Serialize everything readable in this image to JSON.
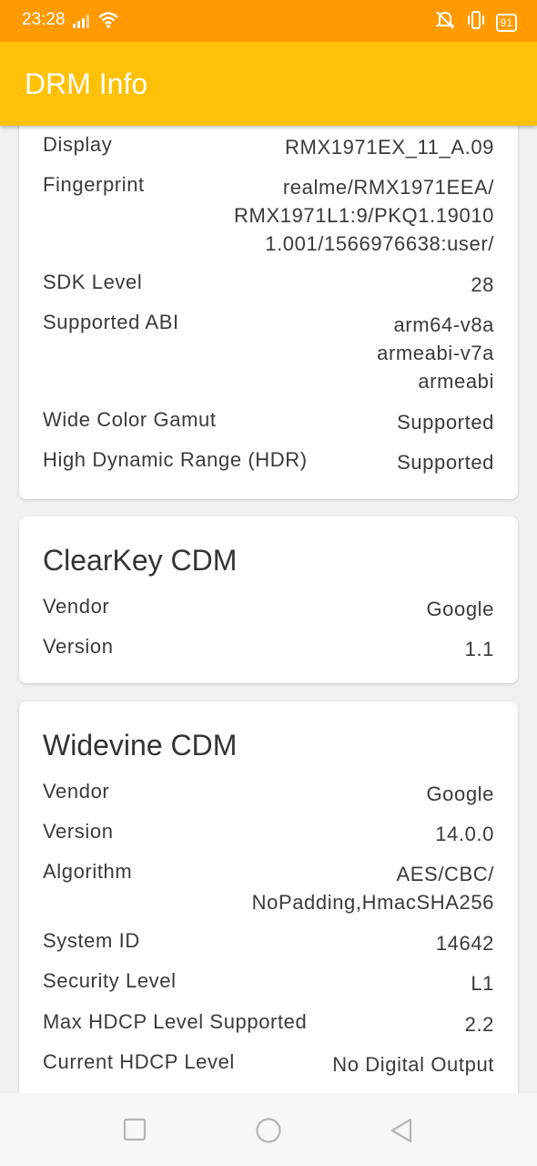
{
  "status": {
    "time": "23:28",
    "battery": "91",
    "icons": [
      "signal-icon",
      "wifi-icon",
      "mute-icon",
      "vibrate-icon",
      "battery-icon"
    ]
  },
  "appbar": {
    "title": "DRM Info"
  },
  "system": {
    "display_label": "Display",
    "display_value": "RMX1971EX_11_A.09",
    "fingerprint_label": "Fingerprint",
    "fingerprint_lines": [
      "realme/RMX1971EEA/",
      "RMX1971L1:9/PKQ1.19010",
      "1.001/1566976638:user/"
    ],
    "sdk_label": "SDK Level",
    "sdk_value": "28",
    "abi_label": "Supported ABI",
    "abi_lines": [
      "arm64-v8a",
      "armeabi-v7a",
      "armeabi"
    ],
    "wcg_label": "Wide Color Gamut",
    "wcg_value": "Supported",
    "hdr_label": "High Dynamic Range (HDR)",
    "hdr_value": "Supported"
  },
  "clearkey": {
    "title": "ClearKey CDM",
    "vendor_label": "Vendor",
    "vendor_value": "Google",
    "version_label": "Version",
    "version_value": "1.1"
  },
  "widevine": {
    "title": "Widevine CDM",
    "vendor_label": "Vendor",
    "vendor_value": "Google",
    "version_label": "Version",
    "version_value": "14.0.0",
    "algorithm_label": "Algorithm",
    "algorithm_lines": [
      "AES/CBC/",
      "NoPadding,HmacSHA256"
    ],
    "system_id_label": "System ID",
    "system_id_value": "14642",
    "security_label": "Security Level",
    "security_value": "L1",
    "max_hdcp_label": "Max HDCP Level Supported",
    "max_hdcp_value": "2.2",
    "current_hdcp_label": "Current HDCP Level",
    "current_hdcp_value": "No Digital Output"
  }
}
